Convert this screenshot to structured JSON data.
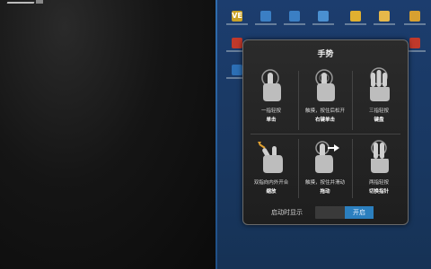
{
  "panel": {
    "title": "手势",
    "gestures": [
      {
        "line1": "一指轻按",
        "line2": "单击",
        "icon": "one-finger-tap-icon"
      },
      {
        "line1": "触摸，按住后松开",
        "line2": "右键单击",
        "icon": "touch-hold-release-icon"
      },
      {
        "line1": "三指轻按",
        "line2": "键盘",
        "icon": "three-finger-tap-icon"
      },
      {
        "line1": "双指向内外开合",
        "line2": "缩放",
        "icon": "pinch-zoom-icon"
      },
      {
        "line1": "触摸，按住并滑动",
        "line2": "拖动",
        "icon": "touch-hold-drag-icon"
      },
      {
        "line1": "两指轻按",
        "line2": "切换指针",
        "icon": "two-finger-tap-icon"
      }
    ],
    "footer_label": "启动时显示",
    "toggle_label": "开启"
  },
  "desktop": {
    "icons": [
      {
        "name": "desktop-icon-1",
        "color": "#c9a227",
        "glyph": "VE"
      },
      {
        "name": "desktop-icon-2",
        "color": "#3b7fc4",
        "glyph": ""
      },
      {
        "name": "desktop-icon-3",
        "color": "#3b7fc4",
        "glyph": ""
      },
      {
        "name": "desktop-icon-4",
        "color": "#4a8fd0",
        "glyph": ""
      },
      {
        "name": "desktop-icon-5",
        "color": "#e0b030",
        "glyph": ""
      },
      {
        "name": "desktop-icon-6",
        "color": "#e6b84a",
        "glyph": ""
      },
      {
        "name": "desktop-icon-7",
        "color": "#d8a030",
        "glyph": ""
      },
      {
        "name": "desktop-icon-8",
        "color": "#c0392b",
        "glyph": ""
      },
      {
        "name": "desktop-icon-9",
        "color": "#c0392b",
        "glyph": ""
      },
      {
        "name": "desktop-icon-10",
        "color": "#2c6fb5",
        "glyph": ""
      }
    ]
  },
  "colors": {
    "accent": "#2b7fbf",
    "panel_bg": "#252525",
    "desktop_bg": "#1c3d6e"
  }
}
